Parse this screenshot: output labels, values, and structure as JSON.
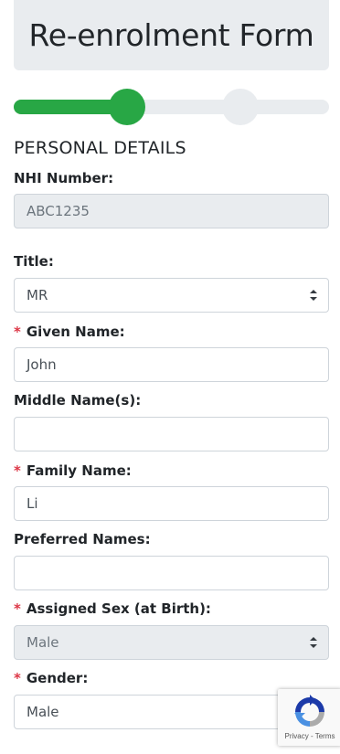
{
  "header": {
    "title": "Re-enrolment Form"
  },
  "progress": {
    "current_step": 1,
    "total_steps": 2
  },
  "section": {
    "title": "PERSONAL DETAILS"
  },
  "fields": {
    "nhi": {
      "label": "NHI Number:",
      "value": "ABC1235"
    },
    "title": {
      "label": "Title:",
      "value": "MR"
    },
    "given": {
      "required": "*",
      "label": "Given Name:",
      "value": "John"
    },
    "middle": {
      "label": "Middle Name(s):",
      "value": ""
    },
    "family": {
      "required": "*",
      "label": "Family Name:",
      "value": "Li"
    },
    "preferred": {
      "label": "Preferred Names:",
      "value": ""
    },
    "sex": {
      "required": "*",
      "label": "Assigned Sex (at Birth):",
      "value": "Male"
    },
    "gender": {
      "required": "*",
      "label": "Gender:",
      "value": "Male"
    }
  },
  "recaptcha": {
    "privacy": "Privacy",
    "separator": " - ",
    "terms": "Terms"
  },
  "colors": {
    "accent": "#28a745",
    "required": "#dc3545",
    "disabled_bg": "#e9ecef"
  }
}
